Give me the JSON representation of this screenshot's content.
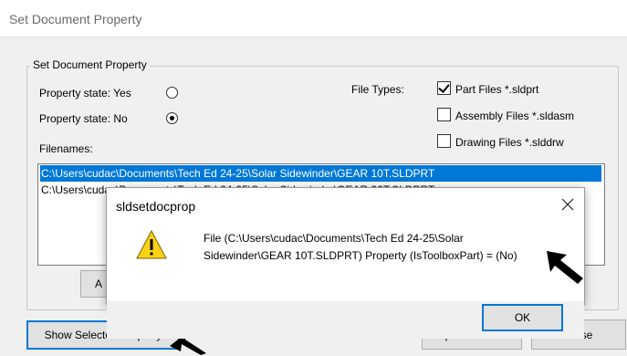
{
  "window": {
    "title": "Set Document Property"
  },
  "group": {
    "label": "Set Document Property",
    "property_yes_label": "Property state: Yes",
    "property_no_label": "Property state: No",
    "property_yes_checked": false,
    "property_no_checked": true,
    "file_types_label": "File Types:",
    "file_types": [
      {
        "label": "Part Files *.sldprt",
        "checked": true
      },
      {
        "label": "Assembly Files *.sldasm",
        "checked": false
      },
      {
        "label": "Drawing Files *.slddrw",
        "checked": false
      }
    ],
    "filenames_label": "Filenames:",
    "files": [
      {
        "path": "C:\\Users\\cudac\\Documents\\Tech Ed 24-25\\Solar Sidewinder\\GEAR 10T.SLDPRT",
        "selected": true
      },
      {
        "path": "C:\\Users\\cudac\\Documents\\Tech Ed 24-25\\Solar Sidewinder\\GEAR 32T.SLDPRT",
        "selected": false
      }
    ]
  },
  "buttons": {
    "show_selected_property": "Show Selected Property",
    "update_status": "Update Status",
    "close": "Close",
    "hidden_button_fragment": "A"
  },
  "message_box": {
    "title": "sldsetdocprop",
    "line1": "File (C:\\Users\\cudac\\Documents\\Tech Ed 24-25\\Solar",
    "line2": "Sidewinder\\GEAR 10T.SLDPRT) Property (IsToolboxPart) = (No)",
    "ok_label": "OK",
    "icon": "warning-icon",
    "icon_color": "#fcd116"
  },
  "colors": {
    "selection": "#0078d7",
    "focus_border": "#0078d7"
  }
}
